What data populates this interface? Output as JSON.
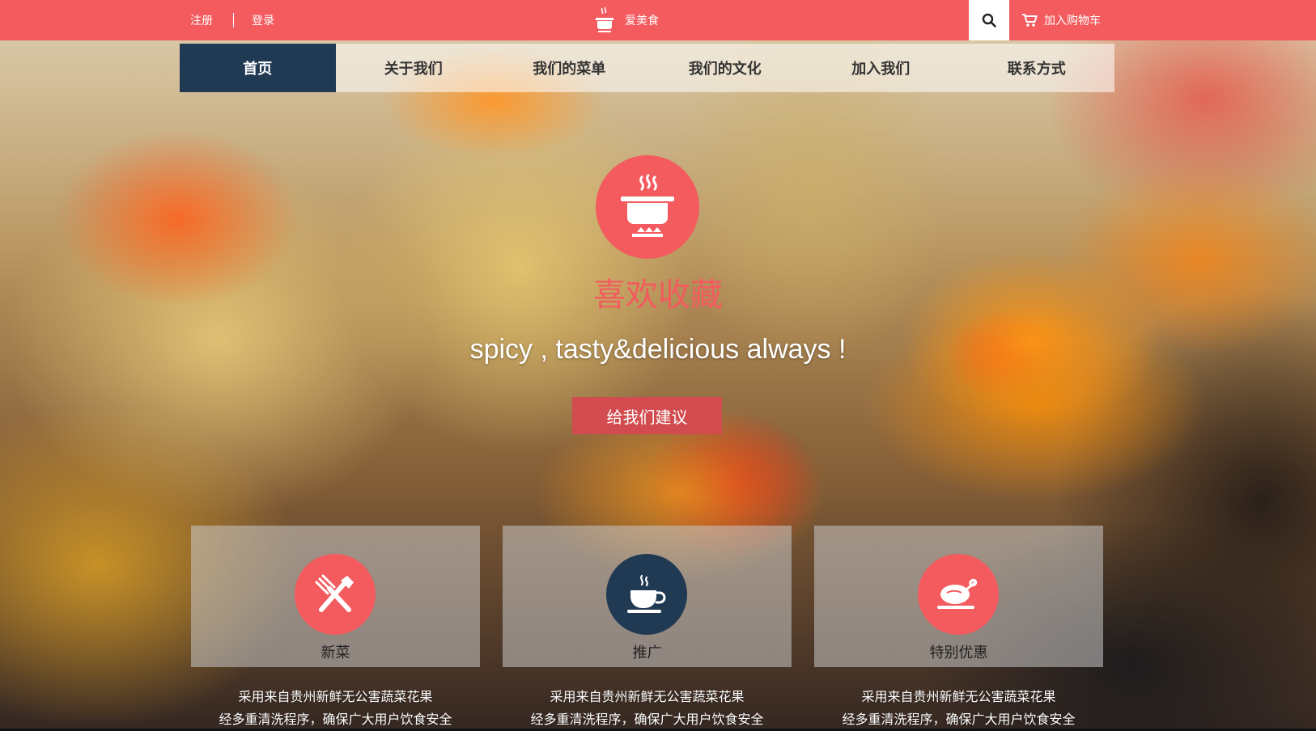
{
  "topbar": {
    "register": "注册",
    "login": "登录",
    "brand": "爱美食",
    "cart": "加入购物车",
    "color": "#f35b5f"
  },
  "nav": {
    "items": [
      "首页",
      "关于我们",
      "我们的菜单",
      "我们的文化",
      "加入我们",
      "联系方式"
    ],
    "active": "首页",
    "active_color": "#203a54"
  },
  "hero": {
    "icon": "cooking-pot-icon",
    "title": "喜欢收藏",
    "subtitle": "spicy , tasty&delicious always !",
    "button": "给我们建议"
  },
  "features": [
    {
      "icon": "fork-knife-icon",
      "name": "新菜",
      "line1": "采用来自贵州新鲜无公害蔬菜花果",
      "line2": "经多重清洗程序，确保广大用户饮食安全",
      "color": "#f35b5f"
    },
    {
      "icon": "coffee-cup-icon",
      "name": "推广",
      "line1": "采用来自贵州新鲜无公害蔬菜花果",
      "line2": "经多重清洗程序，确保广大用户饮食安全",
      "color": "#203a54"
    },
    {
      "icon": "roast-chicken-icon",
      "name": "特别优惠",
      "line1": "采用来自贵州新鲜无公害蔬菜花果",
      "line2": "经多重清洗程序，确保广大用户饮食安全",
      "color": "#f35b5f"
    }
  ]
}
